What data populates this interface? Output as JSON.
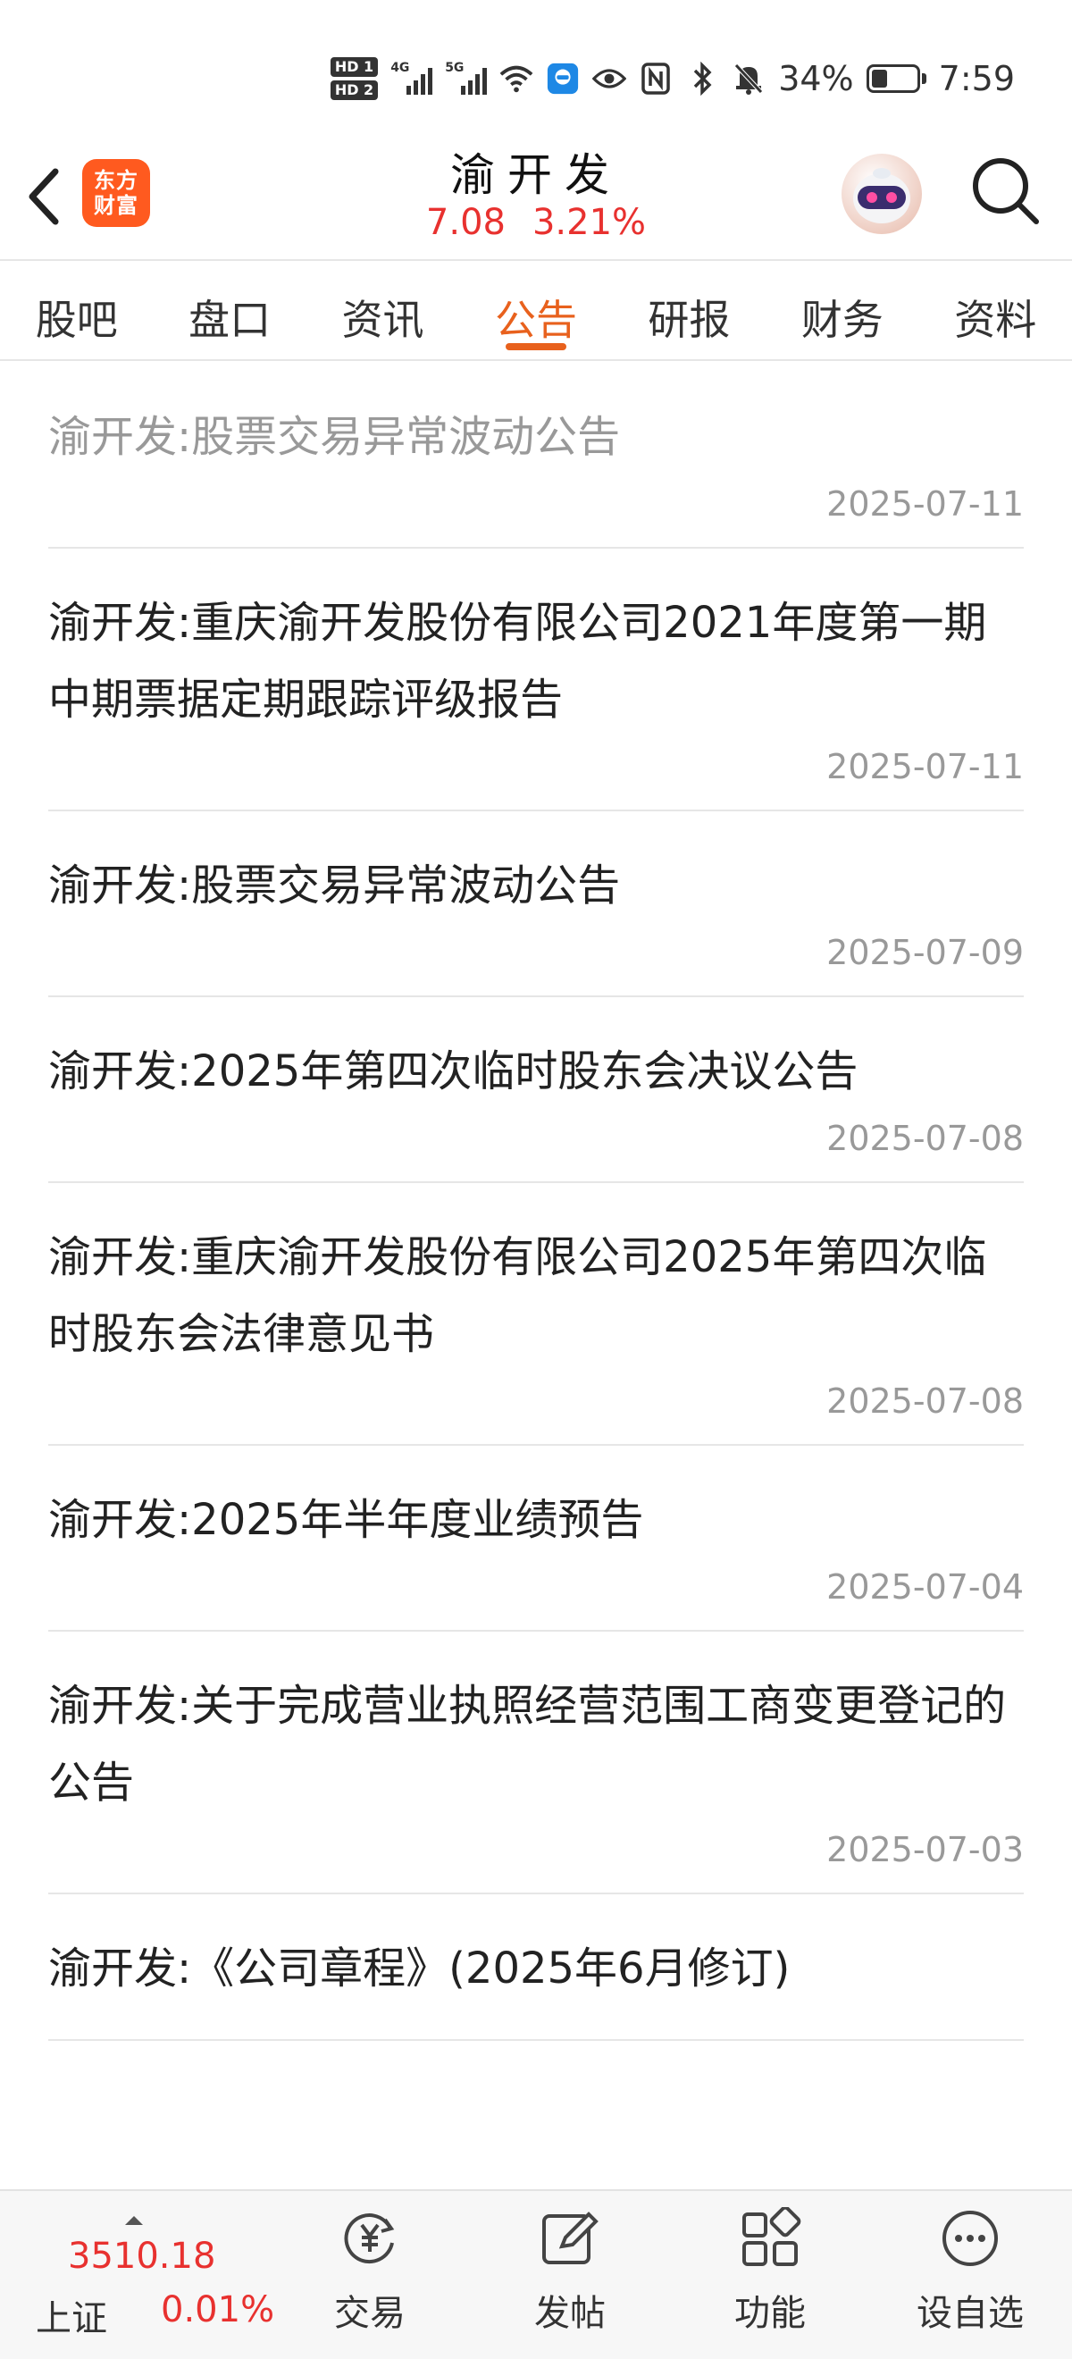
{
  "status_bar": {
    "hd1": "HD 1",
    "hd2": "HD 2",
    "sig1_tag": "4G",
    "sig2_tag": "5G",
    "battery": "34%",
    "time": "7:59",
    "battery_level": 0.34
  },
  "header": {
    "logo_line1": "东方",
    "logo_line2": "财富",
    "stock_name": "渝开发",
    "price": "7.08",
    "change_pct": "3.21%",
    "accent_color": "#e8611d",
    "up_color": "#e8312f"
  },
  "tabs": [
    {
      "label": "股吧",
      "active": false
    },
    {
      "label": "盘口",
      "active": false
    },
    {
      "label": "资讯",
      "active": false
    },
    {
      "label": "公告",
      "active": true
    },
    {
      "label": "研报",
      "active": false
    },
    {
      "label": "财务",
      "active": false
    },
    {
      "label": "资料",
      "active": false
    }
  ],
  "announcements": [
    {
      "title": "",
      "date": "2025-07-11",
      "read": false
    },
    {
      "title": "渝开发:股票交易异常波动公告",
      "date": "2025-07-11",
      "read": true
    },
    {
      "title": "渝开发:重庆渝开发股份有限公司2021年度第一期中期票据定期跟踪评级报告",
      "date": "2025-07-11",
      "read": false
    },
    {
      "title": "渝开发:股票交易异常波动公告",
      "date": "2025-07-09",
      "read": false
    },
    {
      "title": "渝开发:2025年第四次临时股东会决议公告",
      "date": "2025-07-08",
      "read": false
    },
    {
      "title": "渝开发:重庆渝开发股份有限公司2025年第四次临时股东会法律意见书",
      "date": "2025-07-08",
      "read": false
    },
    {
      "title": "渝开发:2025年半年度业绩预告",
      "date": "2025-07-04",
      "read": false
    },
    {
      "title": "渝开发:关于完成营业执照经营范围工商变更登记的公告",
      "date": "2025-07-03",
      "read": false
    },
    {
      "title": "渝开发:《公司章程》(2025年6月修订)",
      "date": "",
      "read": false
    }
  ],
  "bottom_bar": {
    "index_value": "3510.18",
    "index_name": "上证",
    "index_pct": "0.01%",
    "nav": [
      {
        "label": "交易",
        "icon": "yen-exchange-icon"
      },
      {
        "label": "发帖",
        "icon": "edit-post-icon"
      },
      {
        "label": "功能",
        "icon": "grid-function-icon"
      },
      {
        "label": "设自选",
        "icon": "more-dots-icon"
      }
    ]
  }
}
